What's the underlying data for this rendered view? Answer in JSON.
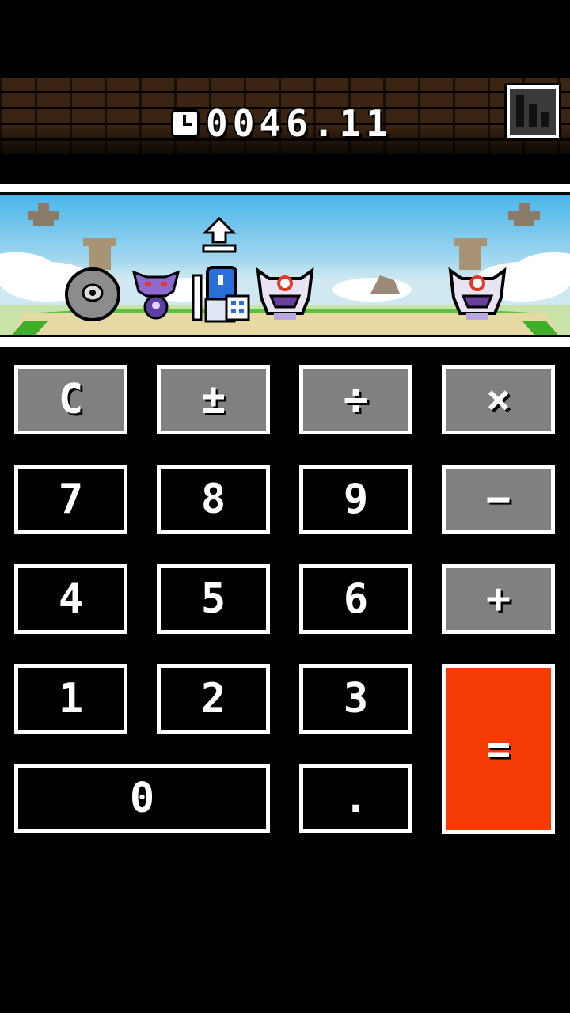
{
  "timer": {
    "value": "0046.11",
    "icon": "clock-icon"
  },
  "stats_button": {
    "icon": "bar-chart-icon"
  },
  "scene": {
    "level_up_icon": "level-up-arrow-icon",
    "colors": {
      "sky": "#49b5ea",
      "ground": "#e6d9a4",
      "grass": "#3fae2a"
    }
  },
  "keypad": {
    "row1": [
      "C",
      "±",
      "÷",
      "×"
    ],
    "row2": [
      "7",
      "8",
      "9",
      "−"
    ],
    "row3": [
      "4",
      "5",
      "6",
      "+"
    ],
    "row4": [
      "1",
      "2",
      "3"
    ],
    "row5": [
      "0",
      "."
    ],
    "equals": "=",
    "colors": {
      "number": "#000000",
      "operator": "#808080",
      "equals": "#f53b04",
      "border": "#ffffff"
    }
  }
}
